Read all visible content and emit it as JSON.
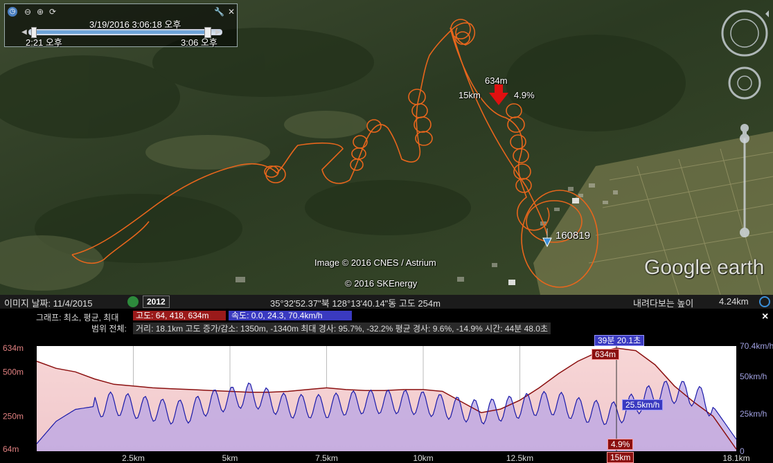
{
  "time_slider": {
    "current_time": "3/19/2016    3:06:18 오후",
    "start_time": "2:21 오후",
    "end_time": "3:06 오후",
    "progress": 1.0
  },
  "map": {
    "marker_altitude": "634m",
    "marker_distance": "15km",
    "marker_grade": "4.9%",
    "placemark_label": "160819",
    "copyright_image": "Image © 2016 CNES / Astrium",
    "copyright_data": "© 2016 SKEnergy",
    "logo": "Google earth",
    "track_color": "#e8661c"
  },
  "status_bar": {
    "imagery_date": "이미지 날짜: 11/4/2015",
    "historical_year": "2012",
    "coordinates": "35°32'52.37\"북 128°13'40.14\"동 고도   254m",
    "eye_alt_label": "내려다보는 높이",
    "eye_alt_value": "4.24km"
  },
  "elevation_profile": {
    "graph_label": "그래프: 최소, 평균, 최대",
    "altitude_stats": "고도: 64, 418, 634m",
    "speed_stats": "속도: 0.0, 24.3, 70.4km/h",
    "range_label": "범위 전체:",
    "range_stats": "거리: 18.1km 고도 증가/감소: 1350m, -1340m 최대 경사: 95.7%, -32.2% 평균 경사: 9.6%, -14.9% 시간: 44분 48.0초",
    "cursor_time": "39분 20.1초",
    "cursor_altitude": "634m",
    "cursor_speed": "25.5km/h",
    "cursor_grade": "4.9%",
    "cursor_distance": "15km",
    "close_symbol": "×",
    "left_axis": [
      "634m",
      "500m",
      "250m",
      "64m"
    ],
    "right_axis": [
      "70.4km/h",
      "50km/h",
      "25km/h",
      "0"
    ],
    "x_ticks": [
      "2.5km",
      "5km",
      "7.5km",
      "10km",
      "12.5km",
      "15km",
      "18.1km"
    ],
    "altitude_color": "#8b1010",
    "speed_color": "#1a1aa8"
  },
  "chart_data": {
    "type": "line",
    "x": [
      0,
      0.5,
      1,
      1.5,
      2,
      2.5,
      3,
      3.5,
      4,
      4.5,
      5,
      5.5,
      6,
      6.5,
      7,
      7.5,
      8,
      8.5,
      9,
      9.5,
      10,
      10.5,
      11,
      11.5,
      12,
      12.5,
      13,
      13.5,
      14,
      14.5,
      15,
      15.5,
      16,
      16.5,
      17,
      17.5,
      18.1
    ],
    "series": [
      {
        "name": "고도",
        "values": [
          560,
          520,
          500,
          460,
          430,
          420,
          410,
          405,
          400,
          395,
          390,
          385,
          385,
          390,
          400,
          410,
          400,
          395,
          395,
          400,
          400,
          390,
          330,
          270,
          290,
          340,
          410,
          490,
          560,
          610,
          634,
          620,
          540,
          420,
          330,
          250,
          64
        ]
      },
      {
        "name": "속도",
        "values": [
          5,
          20,
          28,
          30,
          32,
          30,
          28,
          26,
          27,
          33,
          35,
          38,
          34,
          30,
          30,
          30,
          32,
          33,
          33,
          33,
          32,
          30,
          28,
          26,
          28,
          30,
          32,
          32,
          28,
          26,
          25,
          32,
          38,
          40,
          38,
          30,
          8
        ]
      }
    ],
    "xlabel": "",
    "ylabel": "",
    "xlim": [
      0,
      18.1
    ],
    "ylim_altitude": [
      64,
      634
    ],
    "ylim_speed": [
      0,
      70.4
    ]
  }
}
